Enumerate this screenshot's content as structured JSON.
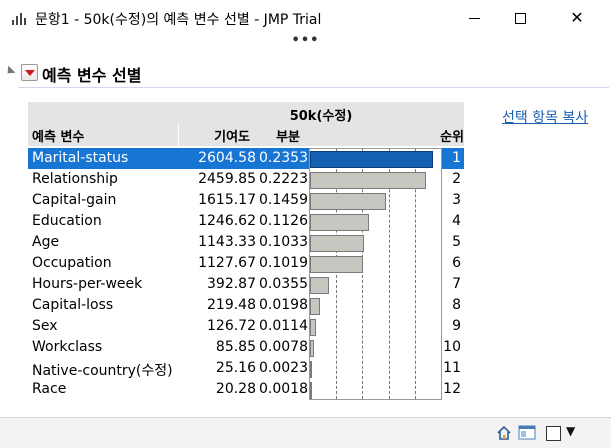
{
  "window": {
    "title": "문항1 - 50k(수정)의 예측 변수 선별 - JMP Trial",
    "minimize_glyph": "—",
    "close_glyph": "✕",
    "toolbar_dots": "•••"
  },
  "report": {
    "outline_title": "예측 변수 선별",
    "copy_link": "선택 항목 복사",
    "response_header": "50k(수정)",
    "columns": {
      "predictor": "예측 변수",
      "contribution": "기여도",
      "portion": "부분",
      "rank": "순위"
    },
    "rows": [
      {
        "predictor": "Marital-status",
        "contribution": "2604.58",
        "portion": "0.2353",
        "rank": "1",
        "selected": true
      },
      {
        "predictor": "Relationship",
        "contribution": "2459.85",
        "portion": "0.2223",
        "rank": "2",
        "selected": false
      },
      {
        "predictor": "Capital-gain",
        "contribution": "1615.17",
        "portion": "0.1459",
        "rank": "3",
        "selected": false
      },
      {
        "predictor": "Education",
        "contribution": "1246.62",
        "portion": "0.1126",
        "rank": "4",
        "selected": false
      },
      {
        "predictor": "Age",
        "contribution": "1143.33",
        "portion": "0.1033",
        "rank": "5",
        "selected": false
      },
      {
        "predictor": "Occupation",
        "contribution": "1127.67",
        "portion": "0.1019",
        "rank": "6",
        "selected": false
      },
      {
        "predictor": "Hours-per-week",
        "contribution": "392.87",
        "portion": "0.0355",
        "rank": "7",
        "selected": false
      },
      {
        "predictor": "Capital-loss",
        "contribution": "219.48",
        "portion": "0.0198",
        "rank": "8",
        "selected": false
      },
      {
        "predictor": "Sex",
        "contribution": "126.72",
        "portion": "0.0114",
        "rank": "9",
        "selected": false
      },
      {
        "predictor": "Workclass",
        "contribution": "85.85",
        "portion": "0.0078",
        "rank": "10",
        "selected": false
      },
      {
        "predictor": "Native-country(수정)",
        "contribution": "25.16",
        "portion": "0.0023",
        "rank": "11",
        "selected": false
      },
      {
        "predictor": "Race",
        "contribution": "20.28",
        "portion": "0.0018",
        "rank": "12",
        "selected": false
      }
    ],
    "bar_scale_max": 0.25,
    "bar_grid_ticks": [
      0.05,
      0.1,
      0.15,
      0.2
    ],
    "colors": {
      "selected_row": "#1775d4",
      "selected_bar": "#1660b4",
      "bar": "#c8c6c0",
      "link": "#1a5fb4"
    }
  },
  "statusbar": {
    "icons": [
      "home-icon",
      "window-layout-icon",
      "dropdown-arrow-icon"
    ],
    "dropdown_glyph": "▼"
  }
}
